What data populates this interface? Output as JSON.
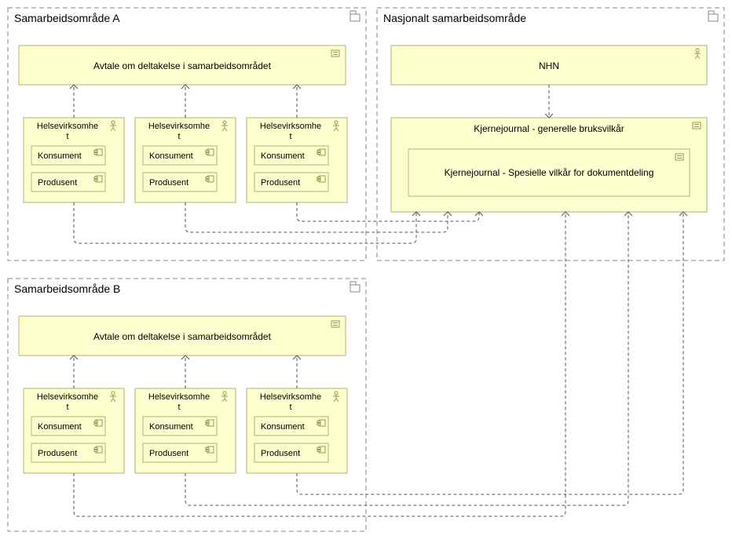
{
  "packages": {
    "a": {
      "title": "Samarbeidsområde A"
    },
    "b": {
      "title": "Samarbeidsområde B"
    },
    "n": {
      "title": "Nasjonalt samarbeidsområde"
    }
  },
  "labels": {
    "agreement": "Avtale om deltakelse i samarbeidsområdet",
    "entity_line1": "Helsevirksomhe",
    "entity_line2": "t",
    "konsument": "Konsument",
    "produsent": "Produsent",
    "nhn": "NHN",
    "kj_general": "Kjernejournal - generelle bruksvilkår",
    "kj_special": "Kjernejournal - Spesielle vilkår for dokumentdeling"
  }
}
